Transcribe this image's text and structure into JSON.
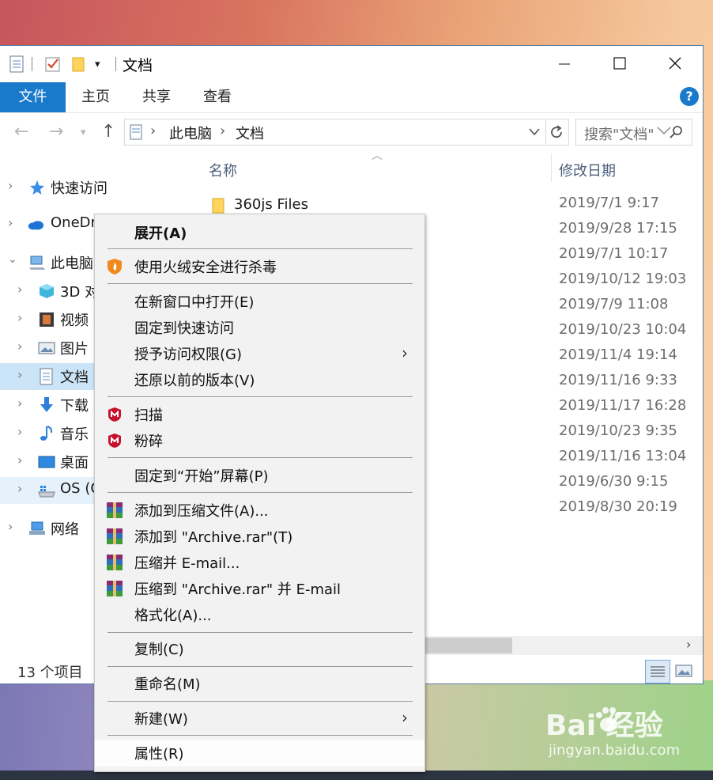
{
  "window": {
    "title": "文档",
    "tabs": {
      "file": "文件",
      "home": "主页",
      "share": "共享",
      "view": "查看"
    },
    "help": "?"
  },
  "address": {
    "crumb1": "此电脑",
    "crumb2": "文档",
    "search_placeholder": "搜索\"文档\""
  },
  "nav": {
    "quick_access": "快速访问",
    "onedrive": "OneDr",
    "this_pc": "此电脑",
    "objects3d": "3D 对",
    "videos": "视频",
    "pictures": "图片",
    "documents": "文档",
    "downloads": "下载",
    "music": "音乐",
    "desktop": "桌面",
    "os": "OS (C",
    "network": "网络"
  },
  "files": {
    "col_name": "名称",
    "col_date": "修改日期",
    "first_folder": "360js Files",
    "dates": [
      "2019/7/1 9:17",
      "2019/9/28 17:15",
      "2019/7/1 10:17",
      "2019/10/12 19:03",
      "2019/7/9 11:08",
      "2019/10/23 10:04",
      "2019/11/4 19:14",
      "2019/11/16 9:33",
      "2019/11/17 16:28",
      "2019/10/23 9:35",
      "2019/11/16 13:04",
      "2019/6/30 9:15",
      "2019/8/30 20:19"
    ]
  },
  "status": {
    "count": "13 个项目"
  },
  "menu": {
    "expand": "展开(A)",
    "huorong": "使用火绒安全进行杀毒",
    "open_new_window": "在新窗口中打开(E)",
    "pin_quick": "固定到快速访问",
    "grant_access": "授予访问权限(G)",
    "restore_versions": "还原以前的版本(V)",
    "scan": "扫描",
    "shred": "粉碎",
    "pin_start": "固定到“开始”屏幕(P)",
    "add_archive": "添加到压缩文件(A)...",
    "add_rar": "添加到 \"Archive.rar\"(T)",
    "compress_email": "压缩并 E-mail...",
    "compress_rar_email": "压缩到 \"Archive.rar\" 并 E-mail",
    "format": "格式化(A)...",
    "copy": "复制(C)",
    "rename": "重命名(M)",
    "new": "新建(W)",
    "properties": "属性(R)"
  },
  "watermark": {
    "logo": "Bai  经验",
    "url": "jingyan.baidu.com"
  },
  "colors": {
    "accent": "#1979ca",
    "selection": "#cce4f7",
    "menu_bg": "#f2f2f2"
  }
}
